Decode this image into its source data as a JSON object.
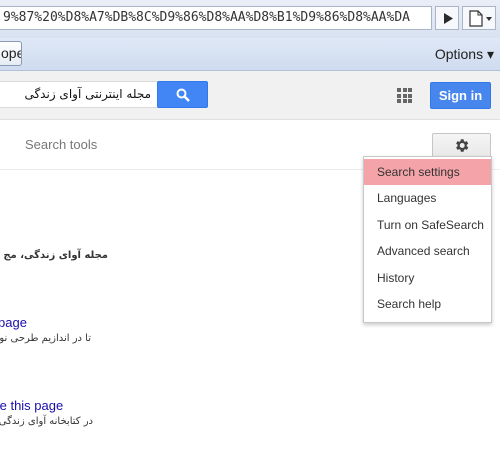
{
  "browser": {
    "address": "9%87%20%D8%A7%DB%8C%D9%86%D8%AA%D8%B1%D9%86%D8%AA%DA",
    "toolbar_button_label": "ope",
    "options_label": "Options ▾"
  },
  "google": {
    "search_query": "مجله اینترنتی آوای زندگی",
    "signin_label": "Sign in",
    "search_tools_label": "Search tools"
  },
  "settings_menu": {
    "items": [
      {
        "label": "Search settings",
        "highlighted": true
      },
      {
        "label": "Languages"
      },
      {
        "label": "Turn on SafeSearch"
      },
      {
        "label": "Advanced search"
      },
      {
        "label": "History"
      },
      {
        "label": "Search help"
      }
    ]
  },
  "results": [
    {
      "snippet": "مجله آوای زندگی، مج"
    },
    {
      "link": "page",
      "snippet": "تا در اندازیم طرحی نو ب"
    },
    {
      "link": "te this page",
      "snippet": "در کتابخانه آوای زندگی، ه"
    }
  ],
  "colors": {
    "accent": "#4285f4",
    "menu_highlight": "#f4a4a9",
    "link": "#1a0dab"
  }
}
